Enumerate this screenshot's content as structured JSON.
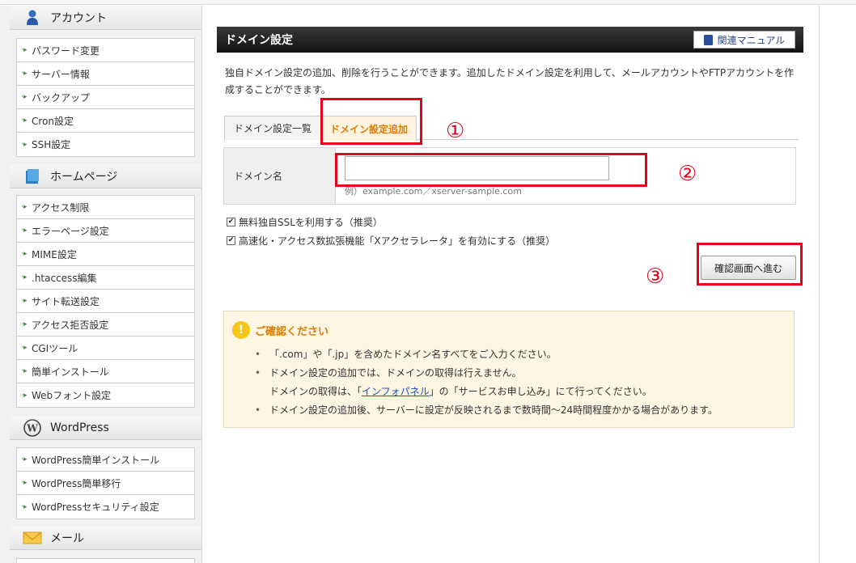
{
  "sidebar": {
    "sections": [
      {
        "title": "アカウント",
        "icon": "user-icon",
        "items": [
          "パスワード変更",
          "サーバー情報",
          "バックアップ",
          "Cron設定",
          "SSH設定"
        ]
      },
      {
        "title": "ホームページ",
        "icon": "book-icon",
        "items": [
          "アクセス制限",
          "エラーページ設定",
          "MIME設定",
          ".htaccess編集",
          "サイト転送設定",
          "アクセス拒否設定",
          "CGIツール",
          "簡単インストール",
          "Webフォント設定"
        ]
      },
      {
        "title": "WordPress",
        "icon": "wordpress-icon",
        "items": [
          "WordPress簡単インストール",
          "WordPress簡単移行",
          "WordPressセキュリティ設定"
        ]
      },
      {
        "title": "メール",
        "icon": "mail-icon",
        "items": []
      }
    ]
  },
  "main": {
    "title": "ドメイン設定",
    "manual_label": "関連マニュアル",
    "description": "独自ドメイン設定の追加、削除を行うことができます。追加したドメイン設定を利用して、メールアカウントやFTPアカウントを作成することができます。",
    "tabs": [
      {
        "label": "ドメイン設定一覧",
        "active": false
      },
      {
        "label": "ドメイン設定追加",
        "active": true
      }
    ],
    "form": {
      "label": "ドメイン名",
      "value": "",
      "example": "例）example.com／xserver-sample.com"
    },
    "checkboxes": [
      {
        "label": "無料独自SSLを利用する（推奨）",
        "checked": true
      },
      {
        "label": "高速化・アクセス数拡張機能「Xアクセラレータ」を有効にする（推奨）",
        "checked": true
      }
    ],
    "confirm_label": "確認画面へ進む",
    "notice": {
      "title": "ご確認ください",
      "item1": "「.com」や「.jp」を含めたドメイン名すべてをご入力ください。",
      "item2_line1": "ドメイン設定の追加では、ドメインの取得は行えません。",
      "item2_line2_pre": "ドメインの取得は、「",
      "item2_link": "インフォパネル",
      "item2_line2_post": "」の「サービスお申し込み」にて行ってください。",
      "item3": "ドメイン設定の追加後、サーバーに設定が反映されるまで数時間〜24時間程度かかる場合があります。"
    }
  },
  "annotations": {
    "markers": [
      "①",
      "②",
      "③"
    ],
    "highlight_color": "#e3001b"
  }
}
